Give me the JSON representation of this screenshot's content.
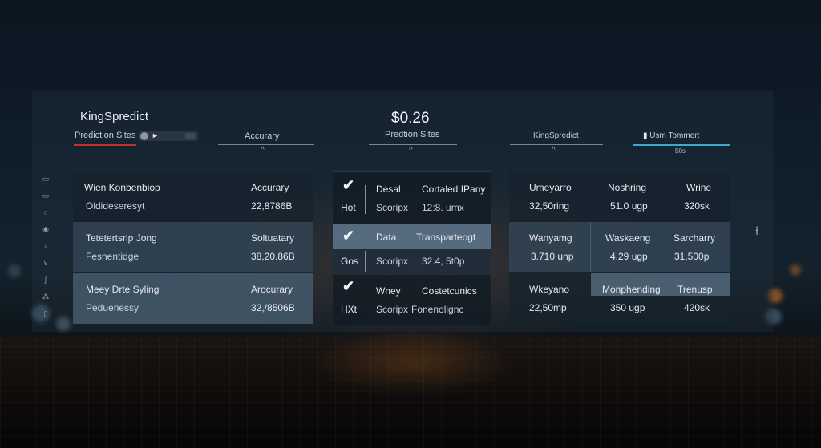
{
  "brand": "KingSpredict",
  "price": "$0.26",
  "tabs": {
    "left_label": "Prediction Sites",
    "accuracy": "Accurary",
    "center": "Predtion Sites",
    "right_brand": "KingSpredict",
    "usm": "Usm Tommert",
    "usm_sub": "$0s"
  },
  "side_icons": [
    "▭",
    "▭",
    "○",
    "◉",
    "▫",
    "∨",
    "∫",
    "⁂",
    "▯"
  ],
  "left_table": {
    "rows": [
      {
        "name": "Wien Konbenbiop",
        "sub": "Oldideseresyt",
        "label": "Accurary",
        "value": "22,8786B"
      },
      {
        "name": "Tetetertsrip Jong",
        "sub": "Fesnentidge",
        "label": "Soltuatary",
        "value": "38,20.86B"
      },
      {
        "name": "Meey Drte Syling",
        "sub": "Peduenessy",
        "label": "Arocurary",
        "value": "32,/8506B"
      }
    ]
  },
  "center_table": {
    "rows": [
      {
        "tag": "Hot",
        "c1": "Desal",
        "c1b": "Scoripx",
        "c2": "Cortaled IPany",
        "c2b": "12:8. umx"
      },
      {
        "tag": "Gos",
        "c1": "Data",
        "c1b": "Scoripx",
        "c2": "Transparteogt",
        "c2b": "32.4, 5t0p"
      },
      {
        "tag": "HXt",
        "c1": "Wney",
        "c1b": "Scoripx",
        "c2": "Costetcunics",
        "c2b": "Fonenolignc"
      }
    ]
  },
  "right_table": {
    "rows": [
      {
        "a": "Umeyarro",
        "a2": "32,50ring",
        "b": "Noshring",
        "b2": "51.0 ugp",
        "c": "Wrine",
        "c2": "320sk"
      },
      {
        "a": "Wanyamg",
        "a2": "3.710 unp",
        "b": "Waskaeng",
        "b2": "4.29 ugp",
        "c": "Sarcharry",
        "c2": "31,500p"
      },
      {
        "a": "Wkeyano",
        "a2": "22,50mp",
        "b": "Monphending",
        "b2": "350 ugp",
        "c": "Trenusp",
        "c2": "420sk"
      }
    ]
  },
  "scroll_glyph": "⟊",
  "toggle_arrow": "►",
  "colors": {
    "accent_red": "#c4302b",
    "accent_blue": "#3fa9c9"
  }
}
